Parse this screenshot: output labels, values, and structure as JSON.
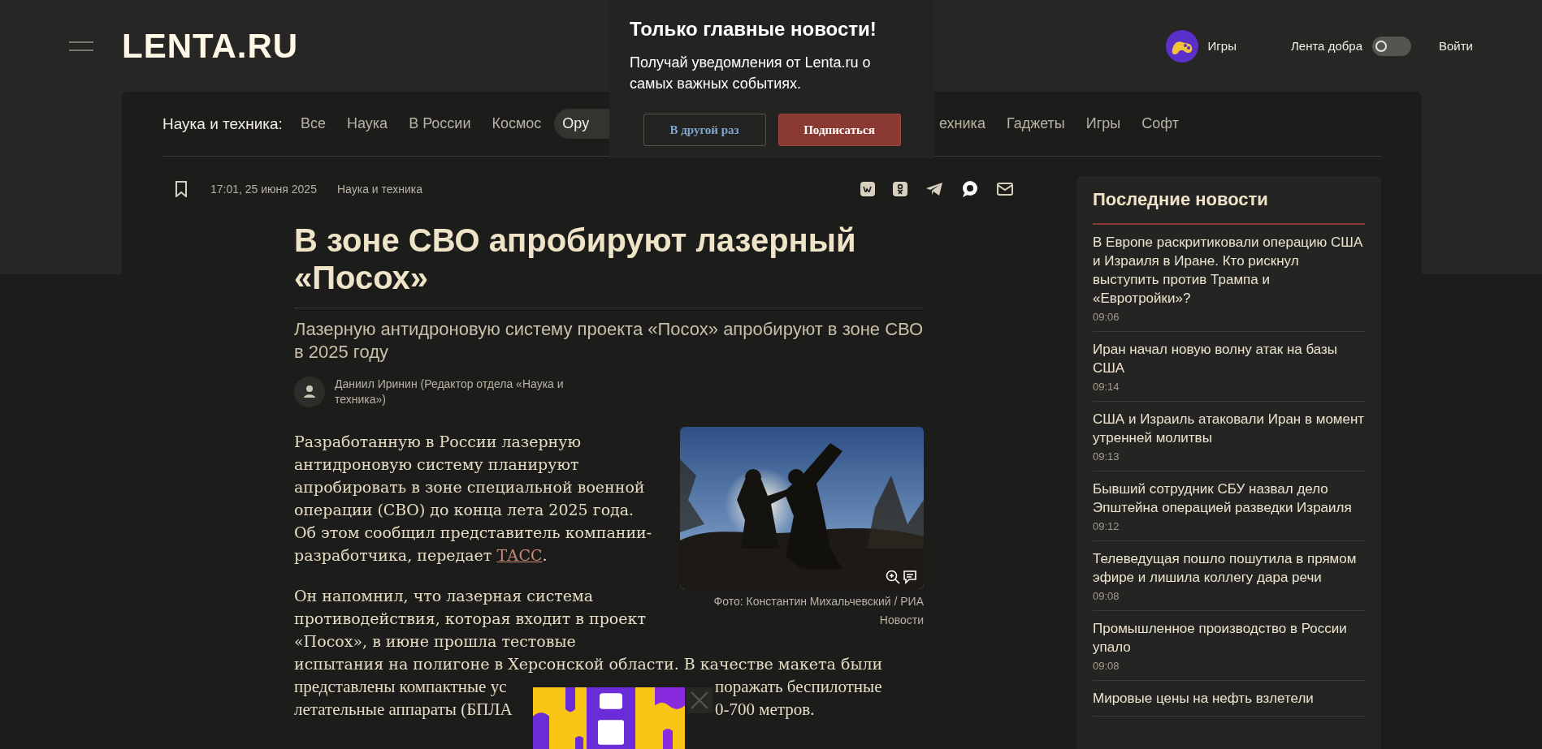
{
  "header": {
    "logo": "LENTA.RU",
    "games": "Игры",
    "kind_feed": {
      "label": "Лента добра",
      "on": false
    },
    "login": "Войти"
  },
  "nav": {
    "label": "Наука и техника:",
    "items_left": [
      {
        "label": "Все",
        "selected": false
      },
      {
        "label": "Наука",
        "selected": false
      },
      {
        "label": "В России",
        "selected": false
      },
      {
        "label": "Космос",
        "selected": false
      },
      {
        "label": "Ору",
        "selected": true
      }
    ],
    "items_right": [
      {
        "label": "ехника",
        "selected": false
      },
      {
        "label": "Гаджеты",
        "selected": false
      },
      {
        "label": "Игры",
        "selected": false
      },
      {
        "label": "Софт",
        "selected": false
      }
    ]
  },
  "popup": {
    "title": "Только главные новости!",
    "text": "Получай уведомления от Lenta.ru о самых важных событиях.",
    "buttons": [
      {
        "label": "В другой раз",
        "kind": "secondary"
      },
      {
        "label": "Подписаться",
        "kind": "primary"
      }
    ]
  },
  "article": {
    "date": "17:01, 25 июня 2025",
    "rubric": "Наука и техника",
    "title": "В зоне СВО апробируют лазерный «Посох»",
    "subtitle": "Лазерную антидроновую систему проекта «Посох» апробируют в зоне СВО в 2025 году",
    "author": "Даниил Иринин (Редактор отдела «Наука и техника»)",
    "photo": {
      "kind": "picture",
      "caption": "Фото: Константин Михальчевский / РИА Новости"
    },
    "paragraph_1": {
      "text": "Разработанную в России лазерную антидроновую систему планируют апробировать в зоне специальной военной операции (СВО) до конца лета 2025 года. Об этом сообщил представитель компании-разработчика, передает ",
      "link": "ТАСС",
      "end": "."
    },
    "paragraph_2": "Он напомнил, что лазерная система противодействия, которая входит в проект «Посох», в июне прошла тестовые",
    "paragraph_2_fragments": [
      [
        "испытания на полигоне в Херсонской области. В качестве макета были"
      ],
      [
        "представлены компактные ус",
        "поражать беспилотные"
      ],
      [
        "летательные аппараты (БПЛА",
        "0-700 метров."
      ]
    ]
  },
  "sidebar": {
    "title": "Последние новости",
    "items": [
      {
        "title": "В Европе раскритиковали операцию США и Израиля в Иране. Кто рискнул выступить против Трампа и «Евротройки»?",
        "time": "09:06"
      },
      {
        "title": "Иран начал новую волну атак на базы США",
        "time": "09:14"
      },
      {
        "title": "США и Израиль атаковали Иран в момент утренней молитвы",
        "time": "09:13"
      },
      {
        "title": "Бывший сотрудник СБУ назвал дело Эпштейна операцией разведки Израиля",
        "time": "09:12"
      },
      {
        "title": "Телеведущая пошло пошутила в прямом эфире и лишила коллегу дара речи",
        "time": "09:08"
      },
      {
        "title": "Промышленное производство в России упало",
        "time": "09:08"
      },
      {
        "title": "Мировые цены на нефть взлетели"
      }
    ]
  }
}
